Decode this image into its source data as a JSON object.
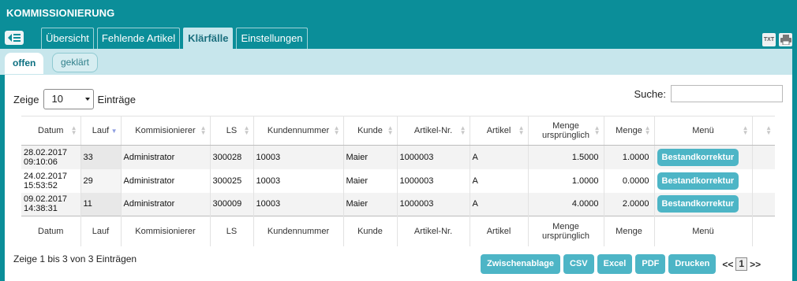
{
  "app": {
    "title": "KOMMISSIONIERUNG"
  },
  "tabs": [
    {
      "label": "Übersicht",
      "active": false
    },
    {
      "label": "Fehlende Artikel",
      "active": false
    },
    {
      "label": "Klärfälle",
      "active": true
    },
    {
      "label": "Einstellungen",
      "active": false
    }
  ],
  "header_icons": {
    "txt_label": "TXT",
    "print": "printer-icon"
  },
  "subtabs": {
    "offen": "offen",
    "geklaert": "geklärt"
  },
  "length": {
    "prefix": "Zeige",
    "value": "10",
    "suffix": "Einträge"
  },
  "search": {
    "label": "Suche:",
    "value": ""
  },
  "table": {
    "columns": [
      "Datum",
      "Lauf",
      "Kommisionierer",
      "LS",
      "Kundennummer",
      "Kunde",
      "Artikel-Nr.",
      "Artikel",
      "Menge ursprünglich",
      "Menge",
      "Menü",
      ""
    ],
    "sorted_column": "Lauf",
    "rows": [
      {
        "datum": "28.02.2017 09:10:06",
        "lauf": "33",
        "kommisionierer": "Administrator",
        "ls": "300028",
        "kundennummer": "10003",
        "kunde": "Maier",
        "artikel_nr": "1000003",
        "artikel": "A",
        "menge_urspruenglich": "1.5000",
        "menge": "1.0000",
        "menu_button": "Bestandkorrektur"
      },
      {
        "datum": "24.02.2017 15:53:52",
        "lauf": "29",
        "kommisionierer": "Administrator",
        "ls": "300025",
        "kundennummer": "10003",
        "kunde": "Maier",
        "artikel_nr": "1000003",
        "artikel": "A",
        "menge_urspruenglich": "1.0000",
        "menge": "0.0000",
        "menu_button": "Bestandkorrektur"
      },
      {
        "datum": "09.02.2017 14:38:31",
        "lauf": "11",
        "kommisionierer": "Administrator",
        "ls": "300009",
        "kundennummer": "10003",
        "kunde": "Maier",
        "artikel_nr": "1000003",
        "artikel": "A",
        "menge_urspruenglich": "4.0000",
        "menge": "2.0000",
        "menu_button": "Bestandkorrektur"
      }
    ]
  },
  "info": "Zeige 1 bis 3 von 3 Einträgen",
  "export_buttons": [
    "Zwischenablage",
    "CSV",
    "Excel",
    "PDF",
    "Drucken"
  ],
  "pager": {
    "prev": "<<",
    "page": "1",
    "next": ">>"
  },
  "colors": {
    "brand": "#0b8e99",
    "accent": "#4db5c6",
    "subbar": "#c7e6ec"
  }
}
